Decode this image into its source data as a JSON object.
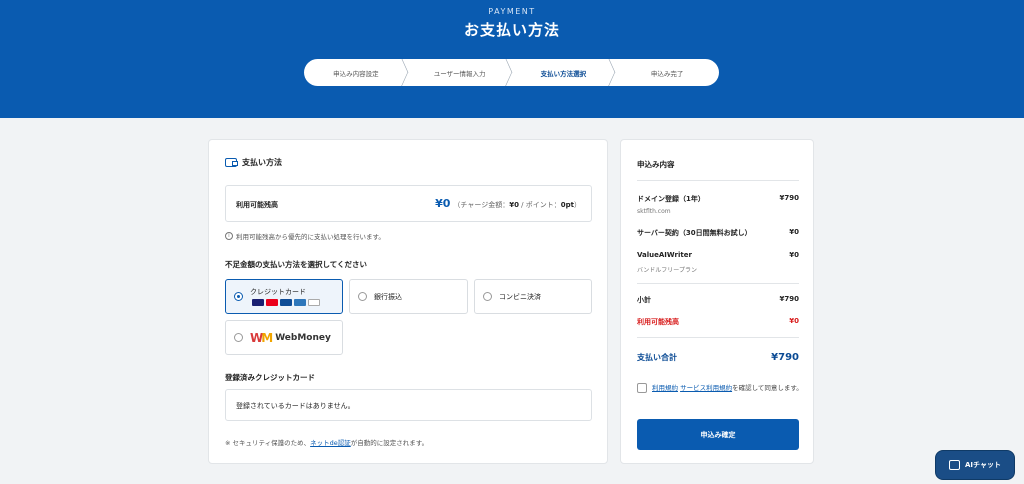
{
  "header": {
    "eyebrow": "PAYMENT",
    "title": "お支払い方法"
  },
  "steps": [
    "申込み内容設定",
    "ユーザー情報入力",
    "支払い方法選択",
    "申込み完了"
  ],
  "payment": {
    "section_title": "支払い方法",
    "balance_label": "利用可能残高",
    "balance_value": "¥0",
    "balance_detail_prefix": "（チャージ金額：",
    "charge_value": "¥0",
    "balance_detail_mid": " / ポイント：",
    "point_value": "0pt",
    "balance_detail_suffix": "）",
    "note": "利用可能残高から優先的に支払い処理を行います。",
    "method_heading": "不足金額の支払い方法を選択してください",
    "methods": [
      {
        "label": "クレジットカード",
        "selected": true
      },
      {
        "label": "銀行振込",
        "selected": false
      },
      {
        "label": "コンビニ決済",
        "selected": false
      },
      {
        "label": "WebMoney",
        "selected": false
      }
    ],
    "registered_heading": "登録済みクレジットカード",
    "no_card": "登録されているカードはありません。",
    "footer_prefix": "※ セキュリティ保護のため、",
    "footer_link": "ネットde認証",
    "footer_suffix": "が自動的に設定されます。"
  },
  "summary": {
    "title": "申込み内容",
    "items": [
      {
        "name": "ドメイン登録（1年）",
        "price": "¥790",
        "sub": "sktflth.com"
      },
      {
        "name": "サーバー契約（30日間無料お試し）",
        "price": "¥0"
      },
      {
        "name": "ValueAIWriter",
        "price": "¥0",
        "sub": "バンドルフリープラン"
      }
    ],
    "subtotal_label": "小計",
    "subtotal_value": "¥790",
    "balance_label": "利用可能残高",
    "balance_value": "¥0",
    "total_label": "支払い合計",
    "total_value": "¥790",
    "agree_link1": "利用規約",
    "agree_link2": "サービス利用規約",
    "agree_text": "を確認して同意します。",
    "confirm_label": "申込み確定"
  },
  "ai_chat_label": "AIチャット",
  "colors": {
    "primary": "#0a5bb0",
    "danger": "#d81b1b"
  }
}
